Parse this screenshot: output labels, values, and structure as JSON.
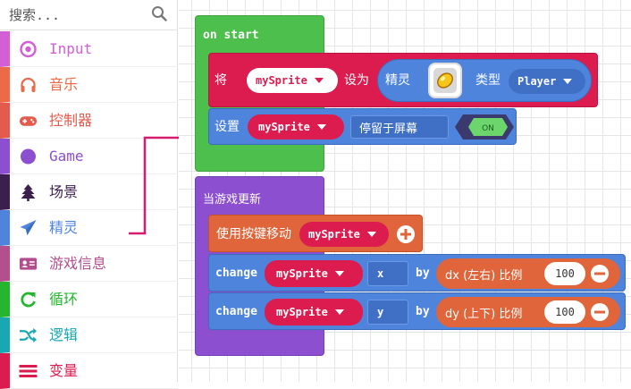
{
  "toolbox": {
    "search_placeholder": "搜索...",
    "categories": [
      {
        "label": "Input",
        "color": "#d25fd6",
        "icon": "target-circle-icon"
      },
      {
        "label": "音乐",
        "color": "#ec6a47",
        "icon": "headphones-icon"
      },
      {
        "label": "控制器",
        "color": "#e35b4d",
        "icon": "gamepad-icon"
      },
      {
        "label": "Game",
        "color": "#8b4fcf",
        "icon": "filled-circle-icon"
      },
      {
        "label": "场景",
        "color": "#3b1f4d",
        "icon": "tree-icon"
      },
      {
        "label": "精灵",
        "color": "#4f84dd",
        "icon": "paper-plane-icon"
      },
      {
        "label": "游戏信息",
        "color": "#b44f8d",
        "icon": "id-card-icon"
      },
      {
        "label": "循环",
        "color": "#25b52e",
        "icon": "refresh-icon"
      },
      {
        "label": "逻辑",
        "color": "#19a7b1",
        "icon": "shuffle-icon"
      },
      {
        "label": "变量",
        "color": "#dc1c4f",
        "icon": "bars-icon"
      }
    ]
  },
  "workspace": {
    "on_start": {
      "label": "on start",
      "set_block": {
        "prefix": "将",
        "variable": "mySprite",
        "mid": "设为",
        "sprite_label": "精灵",
        "kind_label": "类型",
        "kind_value": "Player"
      },
      "stay_block": {
        "prefix": "设置",
        "variable": "mySprite",
        "option": "停留于屏幕",
        "toggle": "ON"
      }
    },
    "on_update": {
      "label": "当游戏更新",
      "move_block": {
        "label": "使用按键移动",
        "variable": "mySprite"
      },
      "change_x": {
        "label": "change",
        "variable": "mySprite",
        "axis": "x",
        "by": "by",
        "expr": "dx (左右) 比例",
        "value": "100"
      },
      "change_y": {
        "label": "change",
        "variable": "mySprite",
        "axis": "y",
        "by": "by",
        "expr": "dy (上下) 比例",
        "value": "100"
      }
    }
  },
  "colors": {
    "loops_green": "#4cbf4c",
    "variables_red": "#dc1c4f",
    "sprites_blue": "#4f84dd",
    "game_purple": "#8b4fcf",
    "controller_orange": "#e0653a"
  }
}
